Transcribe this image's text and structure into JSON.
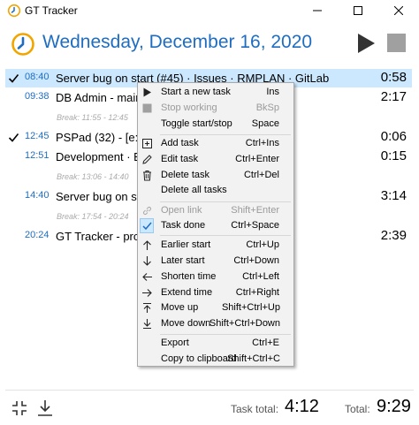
{
  "window": {
    "title": "GT Tracker"
  },
  "header": {
    "date": "Wednesday, December 16, 2020"
  },
  "tasks": [
    {
      "time": "08:40",
      "name": "Server bug on start (#45) · Issues · RMPLAN · GitLab",
      "duration": "0:58",
      "done": true,
      "selected": true
    },
    {
      "time": "09:38",
      "name": "DB Admin - mainter",
      "duration": "2:17",
      "done": false
    },
    {
      "time": "12:45",
      "name": "PSPad (32) - [e:\\PW",
      "duration": "0:06",
      "done": true
    },
    {
      "time": "12:51",
      "name": "Development · Boar",
      "duration": "0:15",
      "done": false
    },
    {
      "time": "14:40",
      "name": "Server bug on start",
      "duration": "3:14",
      "done": false
    },
    {
      "time": "20:24",
      "name": "GT Tracker - profilin",
      "duration": "2:39",
      "done": false
    }
  ],
  "breaks": [
    "Break: 11:55 - 12:45",
    "Break: 13:06 - 14:40",
    "Break: 17:54 - 20:24"
  ],
  "footer": {
    "task_total_label": "Task total:",
    "task_total": "4:12",
    "total_label": "Total:",
    "total": "9:29"
  },
  "context_menu": {
    "items": [
      {
        "label": "Start a new task",
        "shortcut": "Ins",
        "icon": "play-icon",
        "enabled": true
      },
      {
        "label": "Stop working",
        "shortcut": "BkSp",
        "icon": "stop-icon",
        "enabled": false
      },
      {
        "label": "Toggle start/stop",
        "shortcut": "Space",
        "icon": "",
        "enabled": true
      },
      {
        "label": "Add task",
        "shortcut": "Ctrl+Ins",
        "icon": "add-icon",
        "enabled": true
      },
      {
        "label": "Edit task",
        "shortcut": "Ctrl+Enter",
        "icon": "pencil-icon",
        "enabled": true
      },
      {
        "label": "Delete task",
        "shortcut": "Ctrl+Del",
        "icon": "trash-icon",
        "enabled": true
      },
      {
        "label": "Delete all tasks",
        "shortcut": "",
        "icon": "",
        "enabled": true
      },
      {
        "label": "Open link",
        "shortcut": "Shift+Enter",
        "icon": "link-icon",
        "enabled": false
      },
      {
        "label": "Task done",
        "shortcut": "Ctrl+Space",
        "icon": "check-icon",
        "enabled": true,
        "checked": true
      },
      {
        "label": "Earlier start",
        "shortcut": "Ctrl+Up",
        "icon": "arrow-up-icon",
        "enabled": true
      },
      {
        "label": "Later start",
        "shortcut": "Ctrl+Down",
        "icon": "arrow-down-icon",
        "enabled": true
      },
      {
        "label": "Shorten time",
        "shortcut": "Ctrl+Left",
        "icon": "arrow-left-icon",
        "enabled": true
      },
      {
        "label": "Extend time",
        "shortcut": "Ctrl+Right",
        "icon": "arrow-right-icon",
        "enabled": true
      },
      {
        "label": "Move up",
        "shortcut": "Shift+Ctrl+Up",
        "icon": "move-up-icon",
        "enabled": true
      },
      {
        "label": "Move down",
        "shortcut": "Shift+Ctrl+Down",
        "icon": "move-down-icon",
        "enabled": true
      },
      {
        "label": "Export",
        "shortcut": "Ctrl+E",
        "icon": "",
        "enabled": true
      },
      {
        "label": "Copy to clipboard",
        "shortcut": "Shift+Ctrl+C",
        "icon": "",
        "enabled": true
      }
    ]
  },
  "colors": {
    "accent": "#1e6dc1",
    "selection": "#cce8ff",
    "break_text": "#aaaaaa"
  }
}
